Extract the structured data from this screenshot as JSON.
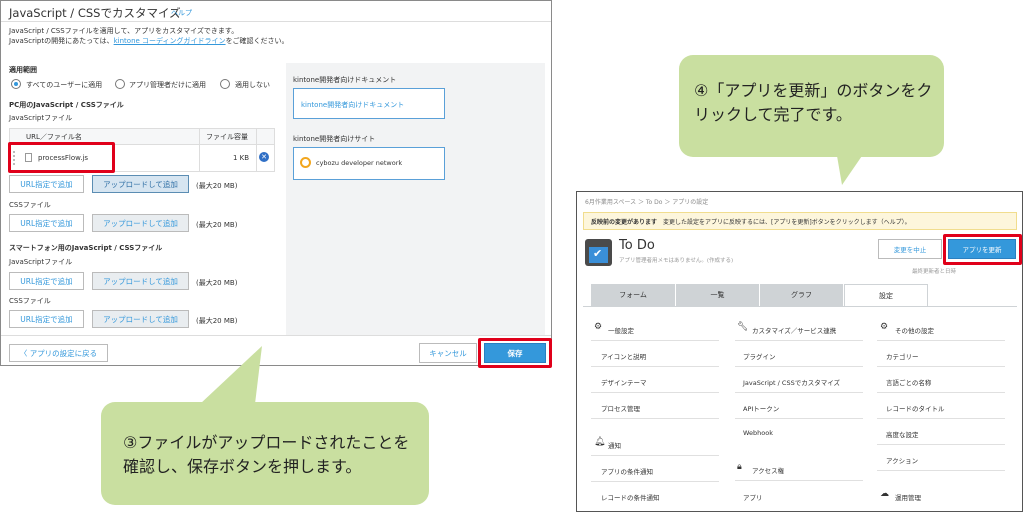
{
  "left": {
    "title": "JavaScript / CSSでカスタマイズ",
    "help": "ヘルプ",
    "desc1": "JavaScript / CSSファイルを適用して、アプリをカスタマイズできます。",
    "desc2_pre": "JavaScriptの開発にあたっては、",
    "desc2_link": "kintone コーディングガイドライン",
    "desc2_post": "をご確認ください。",
    "scope_heading": "適用範囲",
    "scope_options": [
      "すべてのユーザーに適用",
      "アプリ管理者だけに適用",
      "適用しない"
    ],
    "pc_heading": "PC用のJavaScript / CSSファイル",
    "js_files_label": "JavaScriptファイル",
    "col_url": "URL／ファイル名",
    "col_size": "ファイル容量",
    "file_name": "processFlow.js",
    "file_size": "1 KB",
    "btn_url": "URL指定で追加",
    "btn_upload": "アップロードして追加",
    "max_size": "(最大20 MB)",
    "css_files_label": "CSSファイル",
    "sp_heading": "スマートフォン用のJavaScript / CSSファイル",
    "side_doc_heading": "kintone開発者向けドキュメント",
    "side_doc_link": "kintone開発者向けドキュメント",
    "side_site_heading": "kintone開発者向けサイト",
    "side_site_link": "cybozu developer network",
    "back_btn": "アプリの設定に戻る",
    "cancel_btn": "キャンセル",
    "save_btn": "保存"
  },
  "callout3": "③ファイルがアップロードされたことを確認し、保存ボタンを押します。",
  "callout4": "④「アプリを更新」のボタンをクリックして完了です。",
  "right": {
    "breadcrumb": "6月作業用スペース ＞ To Do ＞ アプリの設定",
    "notice_bold": "反映前の変更があります",
    "notice_text": "変更した設定をアプリに反映するには、[アプリを更新]ボタンをクリックします（ヘルプ）。",
    "app_name": "To Do",
    "app_memo": "アプリ管理者用メモはありません。(作成する)",
    "btn_discard": "変更を中止",
    "btn_update": "アプリを更新",
    "last_updated": "最終更新者と日時",
    "tabs": [
      "フォーム",
      "一覧",
      "グラフ",
      "設定"
    ],
    "col1_heading": "一般設定",
    "col1_items": [
      "アイコンと説明",
      "デザインテーマ",
      "プロセス管理"
    ],
    "col1_heading2": "通知",
    "col1_items2": [
      "アプリの条件通知",
      "レコードの条件通知"
    ],
    "col2_heading": "カスタマイズ／サービス連携",
    "col2_items": [
      "プラグイン",
      "JavaScript / CSSでカスタマイズ",
      "APIトークン",
      "Webhook"
    ],
    "col2_heading2": "アクセス権",
    "col2_items2": [
      "アプリ"
    ],
    "col3_heading": "その他の設定",
    "col3_items": [
      "カテゴリー",
      "言語ごとの名称",
      "レコードのタイトル",
      "高度な設定",
      "アクション"
    ],
    "col3_heading2": "運用管理"
  },
  "colors": {
    "accent": "#3498db",
    "highlight": "#e0001a",
    "callout": "#c9dfa0"
  }
}
